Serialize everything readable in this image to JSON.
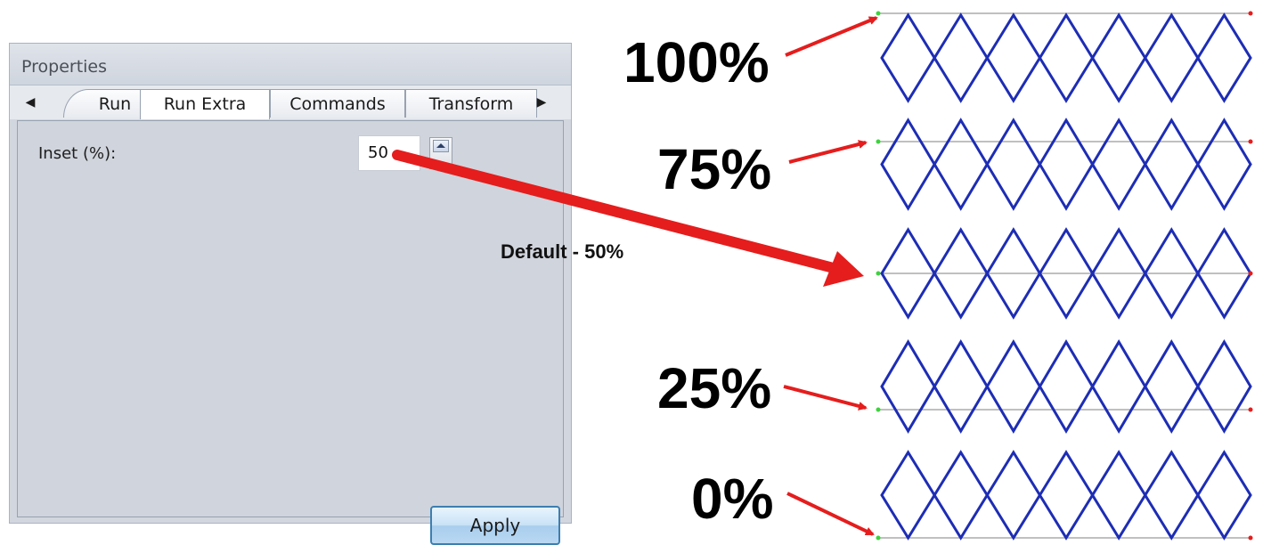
{
  "panel": {
    "title": "Properties",
    "tabs": [
      "Run",
      "Run Extra",
      "Commands",
      "Transform"
    ],
    "active_tab": "Run Extra",
    "field_label": "Inset (%):",
    "field_value": "50",
    "apply_label": "Apply"
  },
  "annotations": {
    "p100": "100%",
    "p75": "75%",
    "default": "Default - 50%",
    "p25": "25%",
    "p0": "0%"
  },
  "diagram": {
    "line_color": "#1d2db5",
    "arrow_color": "#e51d1d",
    "start_dot_color": "#3dd33d",
    "end_dot_color": "#e51d1d"
  }
}
